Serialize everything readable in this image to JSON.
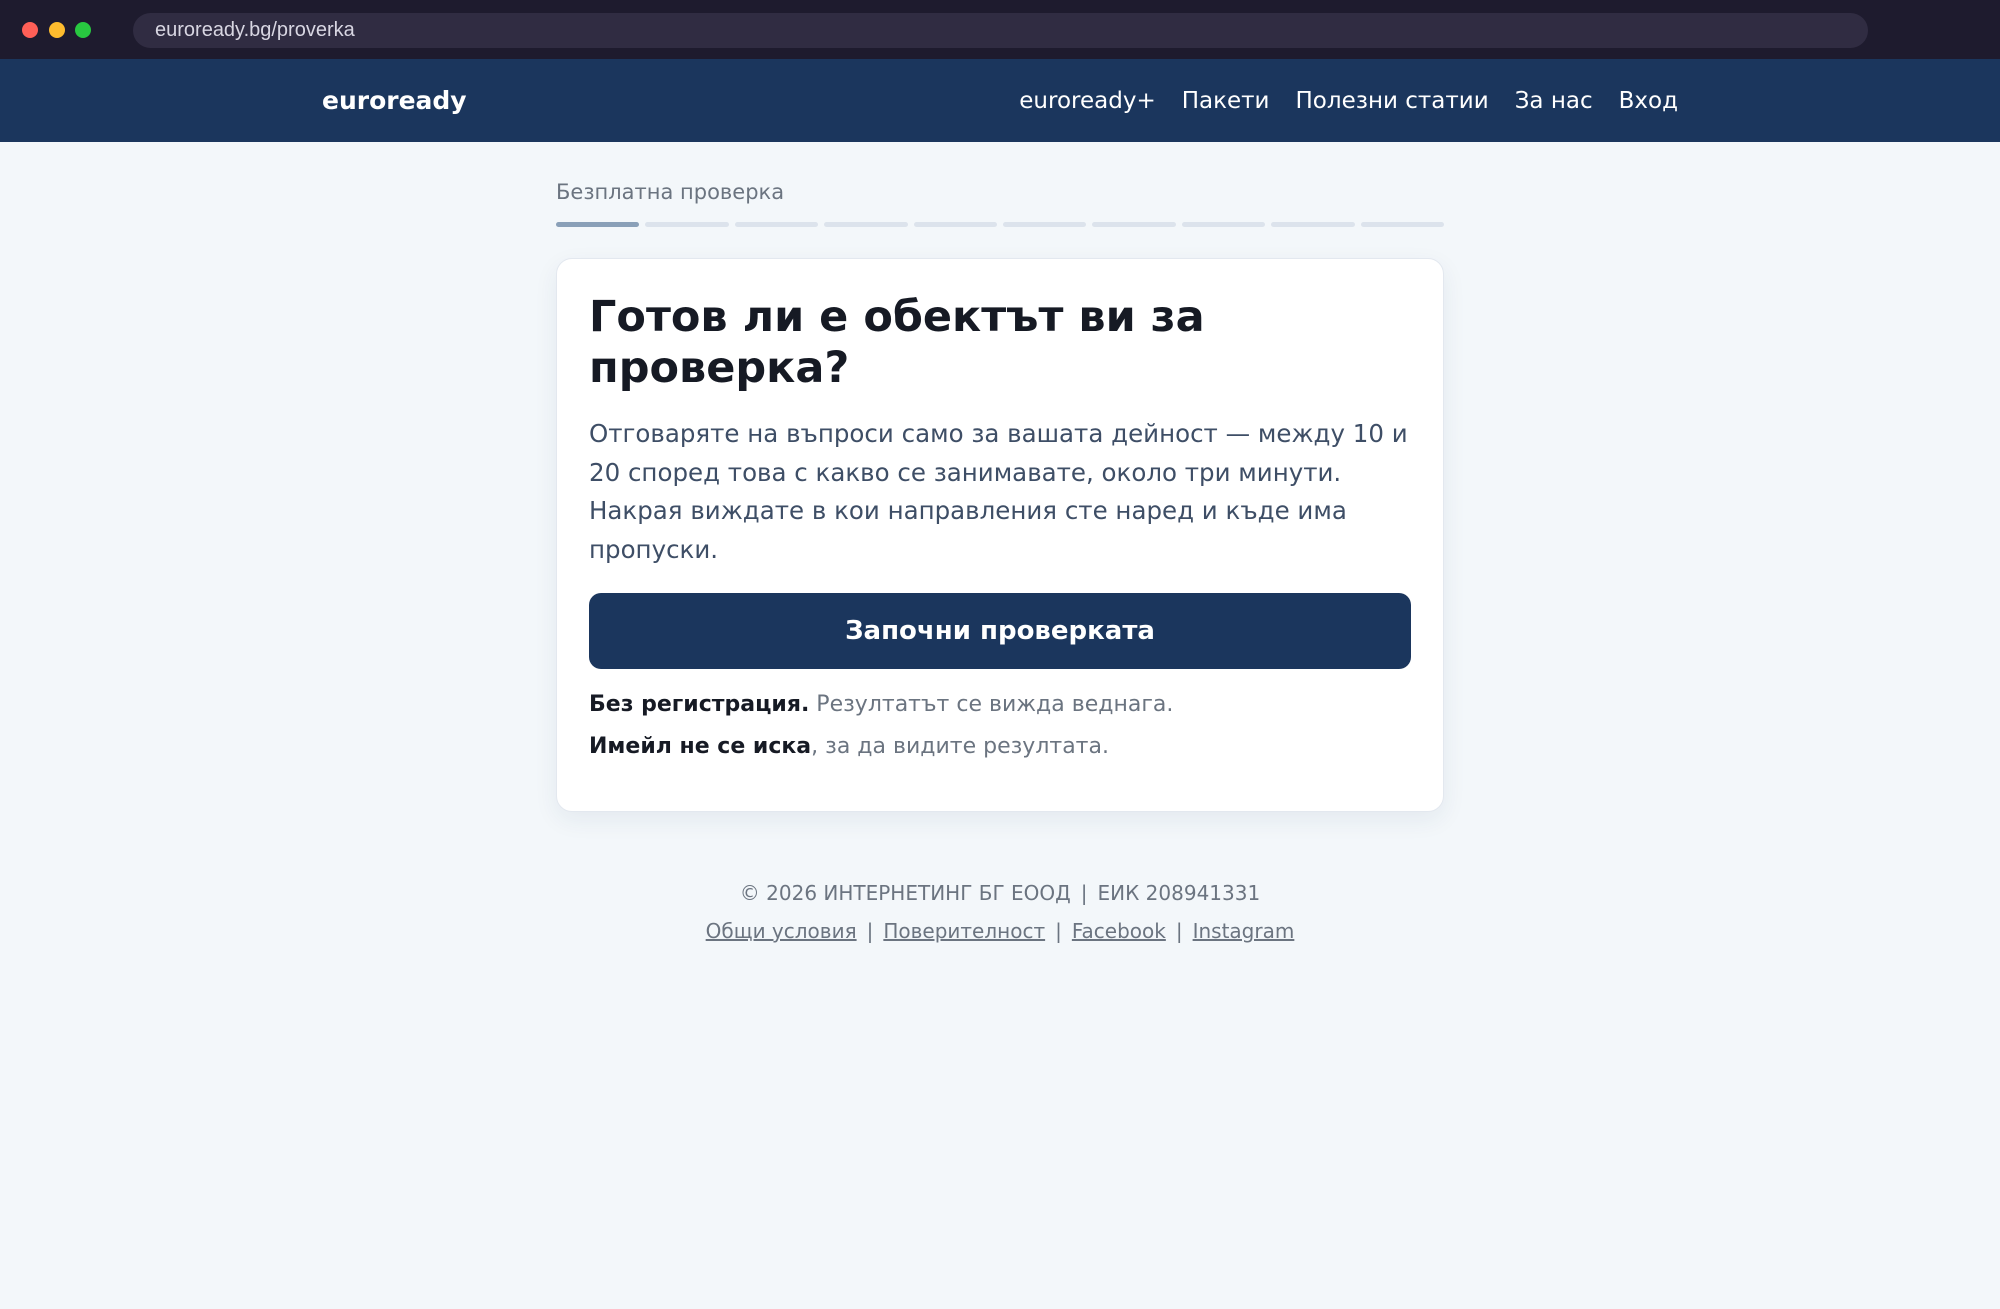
{
  "browser": {
    "url": "euroready.bg/proverka",
    "colors": {
      "close": "#ff5f57",
      "minimize": "#febc2e",
      "maximize": "#28c840"
    }
  },
  "header": {
    "logo": "euroready",
    "nav": [
      "euroready+",
      "Пакети",
      "Полезни статии",
      "За нас",
      "Вход"
    ],
    "background": "#1b365d"
  },
  "quiz": {
    "label": "Безплатна проверка",
    "progress": {
      "current_step": 1,
      "total_steps": 10
    }
  },
  "card": {
    "title": "Готов ли е обектът ви за проверка?",
    "description": "Отговаряте на въпроси само за вашата дейност — между 10 и 20 според това с какво се занимавате, около три минути. Накрая виждате в кои направления сте наред и къде има пропуски.",
    "cta_label": "Започни проверката",
    "note1_bold": "Без регистрация.",
    "note1_rest": " Резултатът се вижда веднага.",
    "note2_bold": "Имейл не се иска",
    "note2_rest": ", за да видите резултата."
  },
  "footer": {
    "copyright": "© 2026 ИНТЕРНЕТИНГ БГ ЕООД",
    "separator": "|",
    "eik": "ЕИК 208941331",
    "links": [
      "Общи условия",
      "Поверителност",
      "Facebook",
      "Instagram"
    ]
  }
}
